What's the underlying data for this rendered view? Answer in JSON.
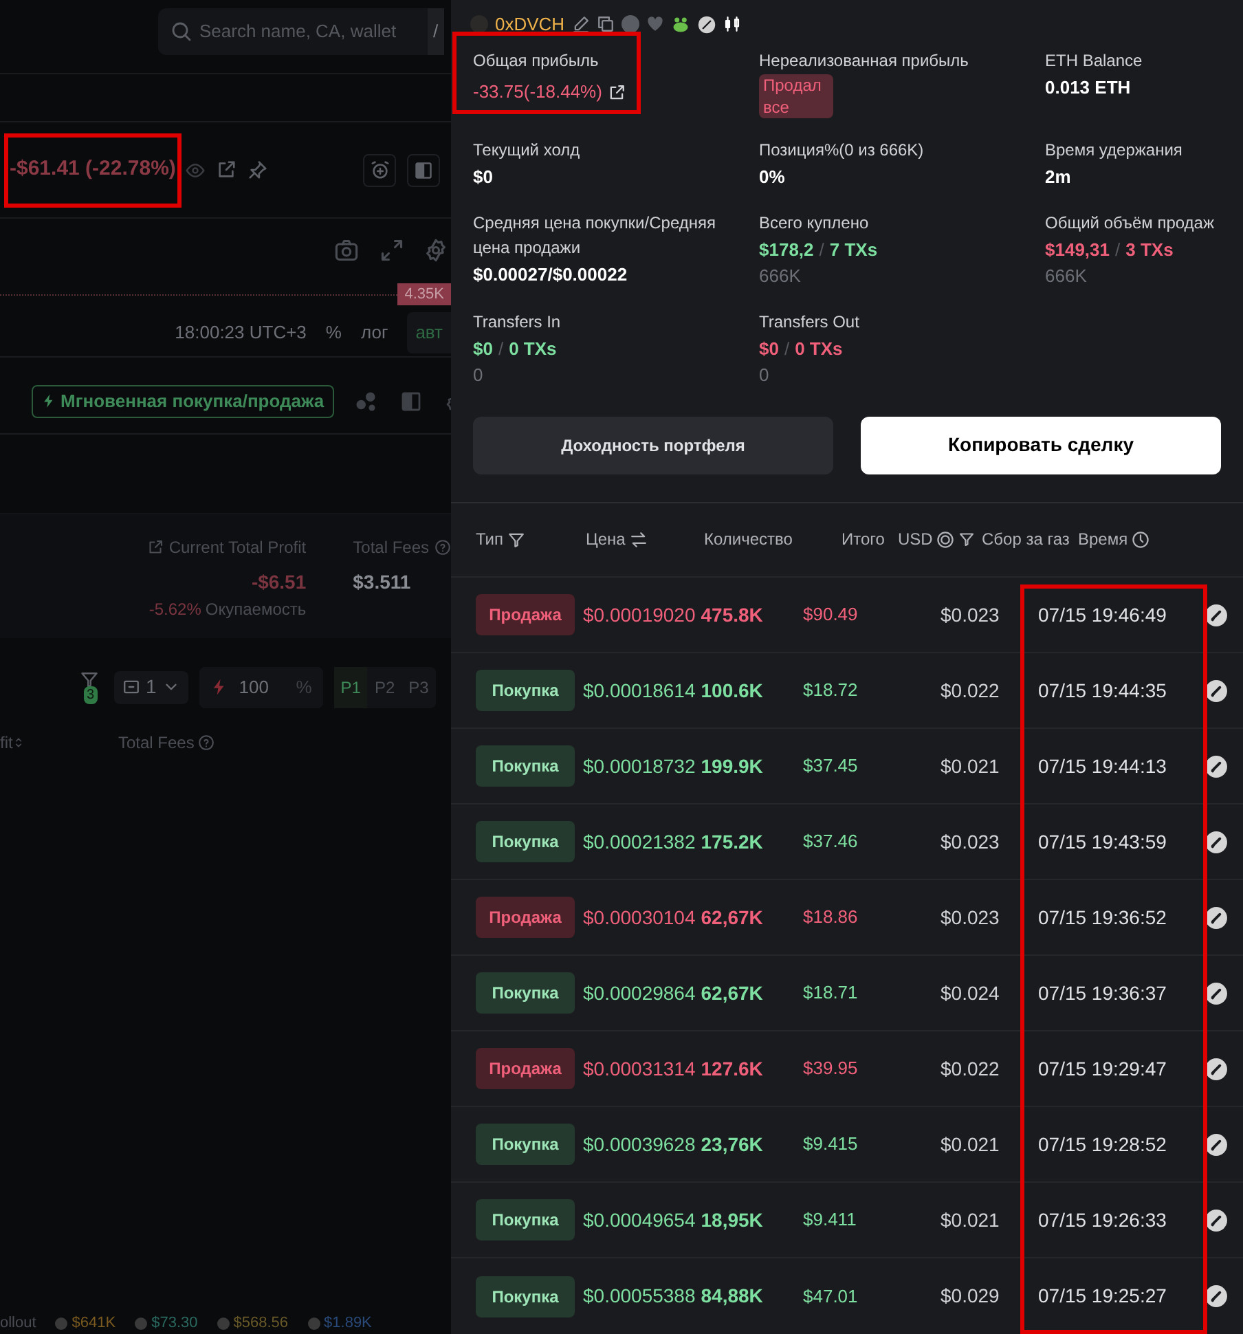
{
  "background": {
    "search": {
      "placeholder": "Search name, CA, wallet",
      "shortcut": "/"
    },
    "pnl": {
      "value": "-$61.41",
      "percent": "(-22.78%)",
      "highlighted": true
    },
    "chart": {
      "price_label": "4.35K",
      "time": "18:00:23 UTC+3",
      "scale_buttons": [
        "%",
        "лог",
        "авт"
      ]
    },
    "instant_trade_button": "Мгновенная покупка/продажа",
    "summary": {
      "profit_label": "Current Total Profit",
      "profit": "-$6.51",
      "roi": "-5.62%",
      "roi_label": "Окупаемость",
      "fees_label": "Total Fees",
      "fees": "$3.511"
    },
    "controls": {
      "filter_count": "3",
      "wallet_count": "1",
      "amount": "100",
      "amount_unit": "%",
      "presets": [
        {
          "label": "P1",
          "selected": true
        },
        {
          "label": "P2",
          "selected": false
        },
        {
          "label": "P3",
          "selected": false
        }
      ]
    },
    "columns": [
      "fit",
      "Total Fees"
    ],
    "tickers": [
      "ollout",
      "$641K",
      "$73.30",
      "$568.56",
      "$1.89K"
    ]
  },
  "panel": {
    "wallet": "0xDVCH",
    "stats": [
      {
        "label": "Общая прибыль",
        "value": "-33.75(-18.44%)",
        "kind": "negative",
        "link": true,
        "highlighted": true
      },
      {
        "label": "Нереализованная прибыль",
        "badge": "Продал все"
      },
      {
        "label": "ETH Balance",
        "value": "0.013 ETH",
        "kind": "plain"
      },
      {
        "label": "Текущий холд",
        "value": "$0",
        "kind": "plain"
      },
      {
        "label": "Позиция%(0 из 666K)",
        "value": "0%",
        "kind": "plain"
      },
      {
        "label": "Время удержания",
        "value": "2m",
        "kind": "plain"
      },
      {
        "label": "Средняя цена покупки/Средняя цена продажи",
        "value": "$0.00027/$0.00022",
        "kind": "plain"
      },
      {
        "label": "Всего куплено",
        "value": "$178,2",
        "separator": "/",
        "txs": "7 TXs",
        "sub": "666K",
        "kind": "positive"
      },
      {
        "label": "Общий объём продаж",
        "value": "$149,31",
        "separator": "/",
        "txs": "3 TXs",
        "sub": "666K",
        "kind": "negative"
      },
      {
        "label": "Transfers In",
        "value": "$0",
        "separator": "/",
        "txs": "0 TXs",
        "sub": "0",
        "kind": "positive"
      },
      {
        "label": "Transfers Out",
        "value": "$0",
        "separator": "/",
        "txs": "0 TXs",
        "sub": "0",
        "kind": "negative"
      }
    ],
    "buttons": [
      {
        "label": "Доходность портфеля",
        "kind": "secondary"
      },
      {
        "label": "Копировать сделку",
        "kind": "primary"
      }
    ],
    "table": {
      "columns": [
        "Тип",
        "Цена",
        "Количество",
        "Итого",
        "USD",
        "Сбор за газ",
        "Время"
      ],
      "time_column_highlighted": true,
      "rows": [
        {
          "kind": "sell",
          "label": "Продажа",
          "price": "$0.00019020",
          "amount": "475.8K",
          "total": "$90.49",
          "gas": "$0.023",
          "time": "07/15 19:46:49"
        },
        {
          "kind": "buy",
          "label": "Покупка",
          "price": "$0.00018614",
          "amount": "100.6K",
          "total": "$18.72",
          "gas": "$0.022",
          "time": "07/15 19:44:35"
        },
        {
          "kind": "buy",
          "label": "Покупка",
          "price": "$0.00018732",
          "amount": "199.9K",
          "total": "$37.45",
          "gas": "$0.021",
          "time": "07/15 19:44:13"
        },
        {
          "kind": "buy",
          "label": "Покупка",
          "price": "$0.00021382",
          "amount": "175.2K",
          "total": "$37.46",
          "gas": "$0.023",
          "time": "07/15 19:43:59"
        },
        {
          "kind": "sell",
          "label": "Продажа",
          "price": "$0.00030104",
          "amount": "62,67K",
          "total": "$18.86",
          "gas": "$0.023",
          "time": "07/15 19:36:52"
        },
        {
          "kind": "buy",
          "label": "Покупка",
          "price": "$0.00029864",
          "amount": "62,67K",
          "total": "$18.71",
          "gas": "$0.024",
          "time": "07/15 19:36:37"
        },
        {
          "kind": "sell",
          "label": "Продажа",
          "price": "$0.00031314",
          "amount": "127.6K",
          "total": "$39.95",
          "gas": "$0.022",
          "time": "07/15 19:29:47"
        },
        {
          "kind": "buy",
          "label": "Покупка",
          "price": "$0.00039628",
          "amount": "23,76K",
          "total": "$9.415",
          "gas": "$0.021",
          "time": "07/15 19:28:52"
        },
        {
          "kind": "buy",
          "label": "Покупка",
          "price": "$0.00049654",
          "amount": "18,95K",
          "total": "$9.411",
          "gas": "$0.021",
          "time": "07/15 19:26:33"
        },
        {
          "kind": "buy",
          "label": "Покупка",
          "price": "$0.00055388",
          "amount": "84,88K",
          "total": "$47.01",
          "gas": "$0.029",
          "time": "07/15 19:25:27"
        }
      ]
    }
  }
}
